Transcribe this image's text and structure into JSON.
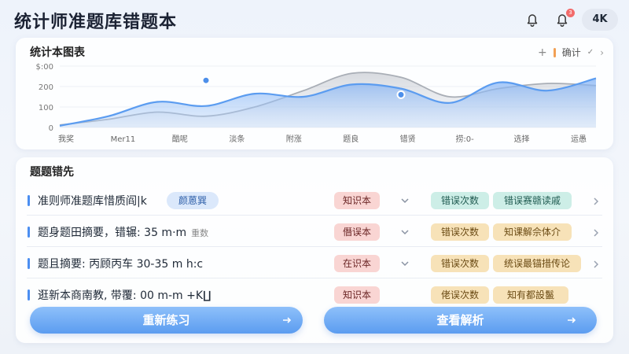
{
  "header": {
    "title": "统计师准题库错题本",
    "notification_badge": "3",
    "resolution": "4K"
  },
  "chart_card": {
    "title": "统计本图表",
    "control_label": "确计",
    "control_check": "✓"
  },
  "chart_data": {
    "type": "line",
    "xlabel": "",
    "ylabel": "",
    "ylim": [
      0,
      300
    ],
    "y_ticks": [
      "0",
      "100",
      "200",
      "300"
    ],
    "y_tick_labels": [
      "0",
      "100",
      "200",
      "$:00"
    ],
    "categories": [
      "我奖",
      "Mer11",
      "酷呢",
      "淡条",
      "附涨",
      "题良",
      "错贤",
      "捞:0-",
      "选择",
      "运愚"
    ],
    "series": [
      {
        "values": [
          8,
          55,
          125,
          105,
          165,
          150,
          210,
          190,
          120,
          220,
          180,
          240
        ]
      },
      {
        "values": [
          12,
          40,
          75,
          55,
          100,
          180,
          265,
          245,
          150,
          190,
          215,
          205
        ]
      }
    ],
    "markers": [
      {
        "series": 0,
        "index": 3,
        "value": 230
      },
      {
        "series": 0,
        "index": 7,
        "value": 160
      }
    ],
    "colors": {
      "primary": "#5b9cf0",
      "secondary": "#a9aeb6"
    }
  },
  "list": {
    "title": "题题错先",
    "rows": [
      {
        "text": "准则师准题库惜质阎|k",
        "sub": "",
        "chip": "颜蒽巽",
        "category": "知识本",
        "tag1": "错误次数",
        "tag1_style": "teal",
        "tag2": "错误赛赣读戚",
        "tag2_style": "teal"
      },
      {
        "text": "题身题田摘要，错辗: 35 m·m",
        "sub": "重数",
        "chip": "",
        "category": "僭误本",
        "tag1": "错误次数",
        "tag1_style": "amber",
        "tag2": "知课解佘体介",
        "tag2_style": "amber"
      },
      {
        "text": "题且摘要: 丙顾丙车 30-35 m h:c",
        "sub": "",
        "chip": "",
        "category": "在识本",
        "tag1": "错误次数",
        "tag1_style": "amber",
        "tag2": "统误最锚措传论",
        "tag2_style": "amber"
      },
      {
        "text": "逛新本商南教, 带覆: 00 m-m +K∐",
        "sub": "",
        "chip": "",
        "category": "知识本",
        "tag1": "佬误次数",
        "tag1_style": "amber",
        "tag2": "知有都設鬣",
        "tag2_style": "amber"
      }
    ]
  },
  "actions": {
    "retry_label": "重新练习",
    "analysis_label": "查看解析"
  }
}
